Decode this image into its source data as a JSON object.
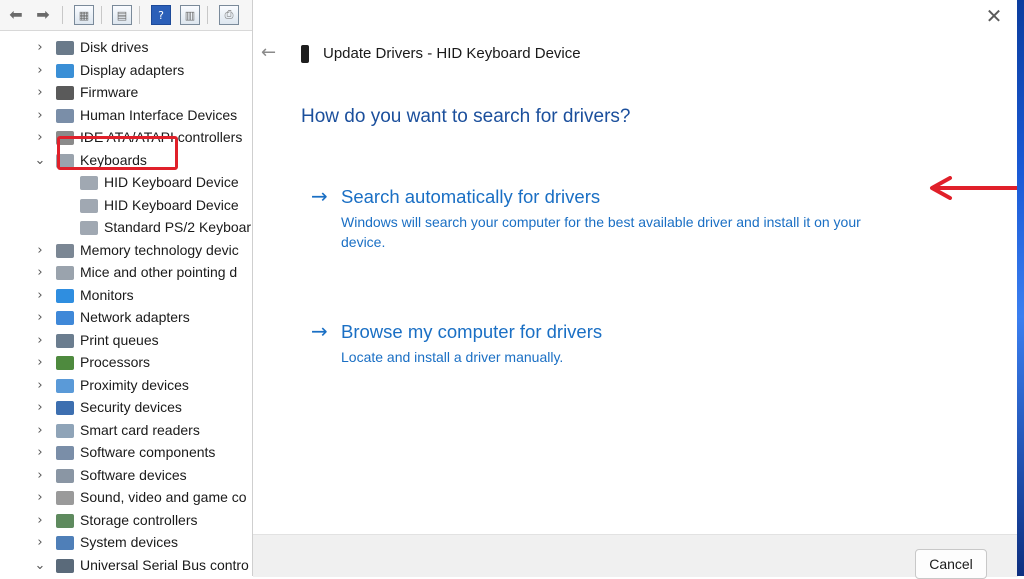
{
  "device_manager": {
    "toolbar": [
      "back-arrow",
      "forward-arrow",
      "show-hide-console-tree",
      "properties",
      "help",
      "show-hide-action-pane",
      "scan-hardware"
    ],
    "tree": [
      {
        "label": "Disk drives",
        "expanded": false,
        "icon": "disk-drive-icon"
      },
      {
        "label": "Display adapters",
        "expanded": false,
        "icon": "display-adapter-icon"
      },
      {
        "label": "Firmware",
        "expanded": false,
        "icon": "firmware-icon"
      },
      {
        "label": "Human Interface Devices",
        "expanded": false,
        "icon": "hid-icon"
      },
      {
        "label": "IDE ATA/ATAPI controllers",
        "expanded": false,
        "icon": "ide-controller-icon"
      },
      {
        "label": "Keyboards",
        "expanded": true,
        "icon": "keyboard-icon"
      },
      {
        "label": "HID Keyboard Device",
        "child": true,
        "icon": "keyboard-icon"
      },
      {
        "label": "HID Keyboard Device",
        "child": true,
        "icon": "keyboard-icon"
      },
      {
        "label": "Standard PS/2 Keyboar",
        "child": true,
        "icon": "keyboard-icon"
      },
      {
        "label": "Memory technology devic",
        "expanded": false,
        "icon": "memory-icon"
      },
      {
        "label": "Mice and other pointing d",
        "expanded": false,
        "icon": "mouse-icon"
      },
      {
        "label": "Monitors",
        "expanded": false,
        "icon": "monitor-icon"
      },
      {
        "label": "Network adapters",
        "expanded": false,
        "icon": "network-adapter-icon"
      },
      {
        "label": "Print queues",
        "expanded": false,
        "icon": "printer-icon"
      },
      {
        "label": "Processors",
        "expanded": false,
        "icon": "processor-icon"
      },
      {
        "label": "Proximity devices",
        "expanded": false,
        "icon": "proximity-icon"
      },
      {
        "label": "Security devices",
        "expanded": false,
        "icon": "security-icon"
      },
      {
        "label": "Smart card readers",
        "expanded": false,
        "icon": "smart-card-icon"
      },
      {
        "label": "Software components",
        "expanded": false,
        "icon": "software-component-icon"
      },
      {
        "label": "Software devices",
        "expanded": false,
        "icon": "software-device-icon"
      },
      {
        "label": "Sound, video and game co",
        "expanded": false,
        "icon": "sound-icon"
      },
      {
        "label": "Storage controllers",
        "expanded": false,
        "icon": "storage-controller-icon"
      },
      {
        "label": "System devices",
        "expanded": false,
        "icon": "system-device-icon"
      },
      {
        "label": "Universal Serial Bus contro",
        "expanded": true,
        "icon": "usb-icon"
      }
    ]
  },
  "dialog": {
    "title": "Update Drivers - HID Keyboard Device",
    "question": "How do you want to search for drivers?",
    "options": [
      {
        "title": "Search automatically for drivers",
        "description": "Windows will search your computer for the best available driver and install it on your device."
      },
      {
        "title": "Browse my computer for drivers",
        "description": "Locate and install a driver manually."
      }
    ],
    "cancel_label": "Cancel",
    "close_icon": "close-icon",
    "back_icon": "back-arrow-icon"
  },
  "colors": {
    "accent": "#1a6fc4",
    "heading": "#1b4f9c",
    "annotation": "#e0202a"
  }
}
